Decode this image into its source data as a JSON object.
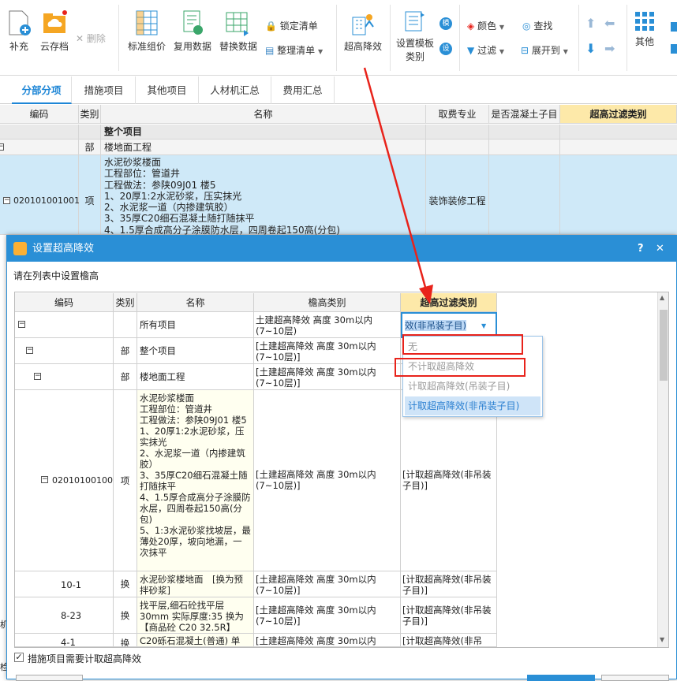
{
  "toolbar": {
    "add": "补充",
    "cloud_save": "云存档",
    "delete": "删除",
    "std_price": "标准组价",
    "reuse": "复用数据",
    "replace": "替换数据",
    "lock_list": "锁定清单",
    "arrange_list": "整理清单",
    "super_high": "超高降效",
    "tmpl_line1": "设置模板",
    "tmpl_line2": "类别",
    "color": "颜色",
    "find": "查找",
    "filter": "过滤",
    "expand": "展开到",
    "other": "其他"
  },
  "tabs": [
    "分部分项",
    "措施项目",
    "其他项目",
    "人材机汇总",
    "费用汇总"
  ],
  "main": {
    "headers": {
      "code": "编码",
      "type": "类别",
      "name": "名称",
      "major": "取费专业",
      "concrete": "是否混凝土子目",
      "filter": "超高过滤类别"
    },
    "row_all": "整个项目",
    "row_floor": {
      "type": "部",
      "name": "楼地面工程"
    },
    "row_item": {
      "code": "020101001001",
      "type": "项",
      "major": "装饰装修工程",
      "desc": [
        "水泥砂浆楼面",
        "工程部位：管道井",
        "工程做法：参陕09J01 楼5",
        "1、20厚1:2水泥砂浆，压实抹光",
        "2、水泥浆一道（内掺建筑胶）",
        "3、35厚C20细石混凝土随打随抹平",
        "4、1.5厚合成高分子涂膜防水层，四周卷起150高(分包)"
      ]
    },
    "left_marks": [
      "机",
      "检"
    ]
  },
  "dialog": {
    "title": "设置超高降效",
    "help": "?",
    "close": "✕",
    "instruction": "请在列表中设置檐高",
    "headers": {
      "code": "编码",
      "type": "类别",
      "name": "名称",
      "eave": "檐高类别",
      "filter": "超高过滤类别"
    },
    "rows": [
      {
        "code": "",
        "type": "",
        "name": "所有项目",
        "eave": "土建超高降效 高度 30m以内(7~10层)",
        "filter": "计取超高降效(非吊装子目)"
      },
      {
        "code": "",
        "type": "部",
        "name": "整个项目",
        "eave": "[土建超高降效 高度 30m以内(7~10层)]",
        "filter": ""
      },
      {
        "code": "",
        "type": "部",
        "name": "楼地面工程",
        "eave": "[土建超高降效 高度 30m以内(7~10层)]",
        "filter": ""
      },
      {
        "code": "020101001001",
        "type": "项",
        "name": "水泥砂浆楼面\n工程部位：管道井\n工程做法：参陕09J01 楼5\n1、20厚1:2水泥砂浆，压实抹光\n2、水泥浆一道（内掺建筑胶）\n3、35厚C20细石混凝土随打随抹平\n4、1.5厚合成高分子涂膜防水层，四周卷起150高(分包)\n5、1:3水泥砂浆找坡层，最薄处20厚，坡向地漏，一次抹平",
        "eave": "[土建超高降效 高度 30m以内(7~10层)]",
        "filter": "[计取超高降效(非吊装子目)]"
      },
      {
        "code": "10-1",
        "type": "换",
        "name": "水泥砂浆楼地面　[换为预拌砂浆]",
        "eave": "[土建超高降效 高度 30m以内(7~10层)]",
        "filter": "[计取超高降效(非吊装子目)]"
      },
      {
        "code": "8-23",
        "type": "换",
        "name": "找平层,细石砼找平层30mm 实际厚度:35 换为【商品砼 C20 32.5R】",
        "eave": "[土建超高降效 高度 30m以内(7~10层)]",
        "filter": "[计取超高降效(非吊装子目)]"
      },
      {
        "code": "4-1",
        "type": "换",
        "name": "C20砾石混凝土(普通) 单",
        "eave": "[土建超高降效 高度 30m以内",
        "filter": "[计取超高降效(非吊"
      }
    ],
    "dropdown": {
      "selected": "效(非吊装子目)",
      "options": [
        "无",
        "不计取超高降效",
        "计取超高降效(吊装子目)",
        "计取超高降效(非吊装子目)"
      ]
    },
    "checkbox_label": "措施项目需要计取超高降效",
    "checkbox_checked": true
  },
  "colors": {
    "accent": "#2a8fd6",
    "highlight_row": "#cfe9f8",
    "header_yellow": "#fde9a9",
    "annotation_red": "#e8231b"
  }
}
